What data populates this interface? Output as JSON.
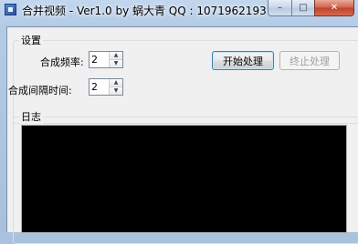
{
  "window": {
    "title": "合并视频 - Ver1.0 by 蜗大青 QQ : 1071962193",
    "buttons": {
      "minimize": "–",
      "maximize": "□",
      "close": "✕"
    }
  },
  "settings": {
    "group_label": "设置",
    "frequency_label": "合成频率:",
    "frequency_value": "2",
    "interval_label": "合成间隔时间:",
    "interval_value": "2",
    "start_button": "开始处理",
    "stop_button": "终止处理"
  },
  "log": {
    "group_label": "日志",
    "content": ""
  },
  "icons": {
    "spin_up": "▲",
    "spin_down": "▼"
  }
}
